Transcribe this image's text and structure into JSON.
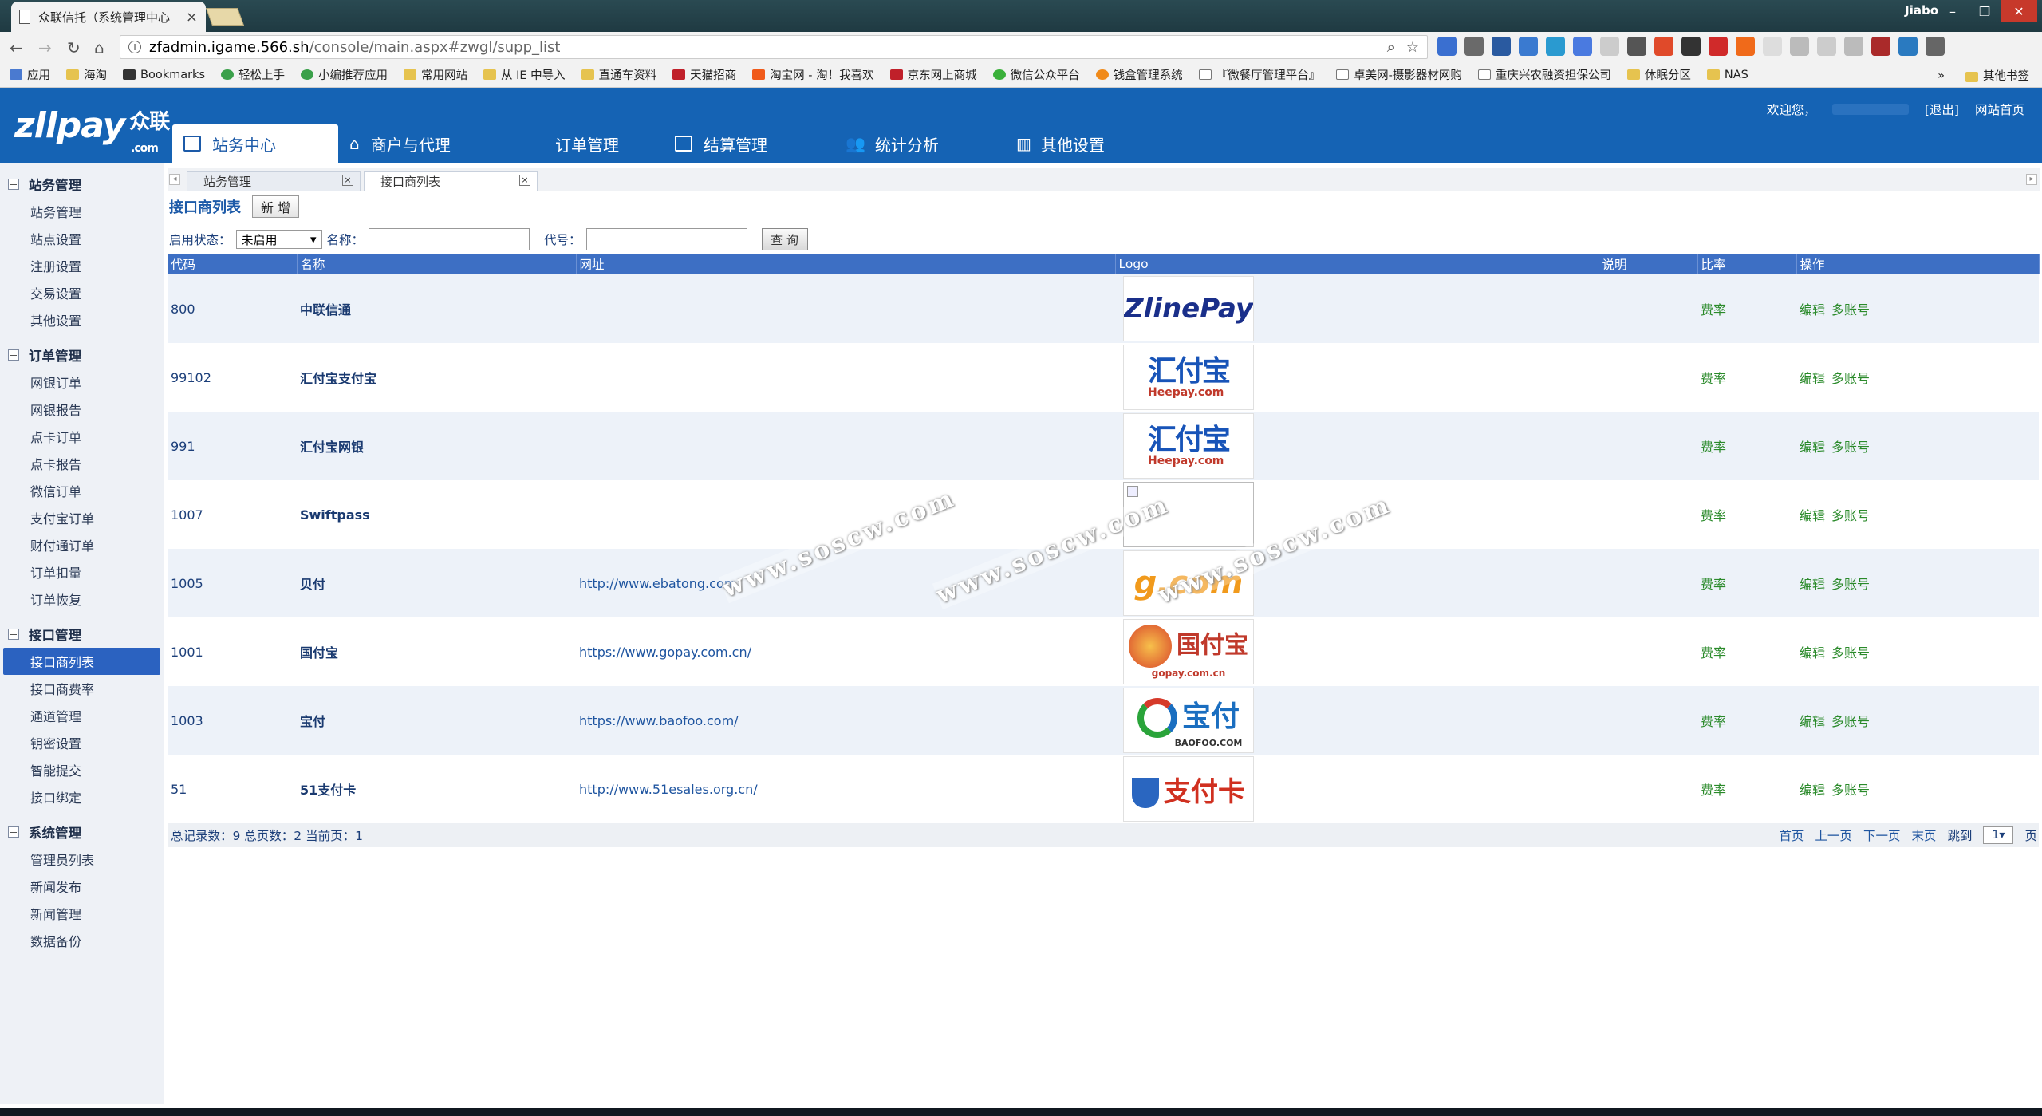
{
  "browser": {
    "tab_title": "众联信托（系统管理中心",
    "window_user": "Jiabo",
    "url_host": "zfadmin.igame.566.sh",
    "url_path": "/console/main.aspx#zwgl/supp_list",
    "bookmarks": [
      "应用",
      "海淘",
      "Bookmarks",
      "轻松上手",
      "小编推荐应用",
      "常用网站",
      "从 IE 中导入",
      "直通车资料",
      "天猫招商",
      "淘宝网 - 淘！我喜欢",
      "京东网上商城",
      "微信公众平台",
      "钱盒管理系统",
      "『微餐厅管理平台』",
      "卓美网-摄影器材网购",
      "重庆兴农融资担保公司",
      "休眠分区",
      "NAS"
    ],
    "bookmarks_overflow": "»",
    "other_bookmarks": "其他书签"
  },
  "header": {
    "logo_text": "zllpay",
    "logo_cn": "众联",
    "logo_sub": ".com",
    "nav": [
      "站务中心",
      "商户与代理",
      "订单管理",
      "结算管理",
      "统计分析",
      "其他设置"
    ],
    "welcome": "欢迎您，",
    "logout": "[退出]",
    "home": "网站首页"
  },
  "sidebar": {
    "groups": [
      {
        "title": "站务管理",
        "items": [
          "站务管理",
          "站点设置",
          "注册设置",
          "交易设置",
          "其他设置"
        ]
      },
      {
        "title": "订单管理",
        "items": [
          "网银订单",
          "网银报告",
          "点卡订单",
          "点卡报告",
          "微信订单",
          "支付宝订单",
          "财付通订单",
          "订单扣量",
          "订单恢复"
        ]
      },
      {
        "title": "接口管理",
        "items": [
          "接口商列表",
          "接口商费率",
          "通道管理",
          "钥密设置",
          "智能提交",
          "接口绑定"
        ]
      },
      {
        "title": "系统管理",
        "items": [
          "管理员列表",
          "新闻发布",
          "新闻管理",
          "数据备份"
        ]
      }
    ],
    "active_item": "接口商列表"
  },
  "content_tabs": [
    {
      "label": "站务管理"
    },
    {
      "label": "接口商列表"
    }
  ],
  "toolbar": {
    "title": "接口商列表",
    "new_button": "新 增"
  },
  "filter": {
    "status_label": "启用状态：",
    "status_value": "未启用",
    "name_label": "名称：",
    "code_label": "代号：",
    "query_button": "查 询"
  },
  "table": {
    "headers": [
      "代码",
      "名称",
      "网址",
      "Logo",
      "说明",
      "比率",
      "操作"
    ],
    "rate_link": "费率",
    "edit_link": "编辑",
    "multi_link": "多账号",
    "rows": [
      {
        "code": "800",
        "name": "中联信通",
        "url": "",
        "logo": "zlinepay",
        "logo_text": "ZlinePay"
      },
      {
        "code": "99102",
        "name": "汇付宝支付宝",
        "url": "",
        "logo": "heepay",
        "logo_text": "汇付宝",
        "logo_sub": "Heepay.com"
      },
      {
        "code": "991",
        "name": "汇付宝网银",
        "url": "",
        "logo": "heepay",
        "logo_text": "汇付宝",
        "logo_sub": "Heepay.com"
      },
      {
        "code": "1007",
        "name": "Swiftpass",
        "url": "",
        "logo": "broken",
        "logo_text": ""
      },
      {
        "code": "1005",
        "name": "贝付",
        "url": "http://www.ebatong.com",
        "logo": "ebatong",
        "logo_text": "g.com"
      },
      {
        "code": "1001",
        "name": "国付宝",
        "url": "https://www.gopay.com.cn/",
        "logo": "gopay",
        "logo_text": "国付宝",
        "logo_sub": "gopay.com.cn"
      },
      {
        "code": "1003",
        "name": "宝付",
        "url": "https://www.baofoo.com/",
        "logo": "baofoo",
        "logo_text": "宝付",
        "logo_sub": "BAOFOO.COM"
      },
      {
        "code": "51",
        "name": "51支付卡",
        "url": "http://www.51esales.org.cn/",
        "logo": "zfk",
        "logo_text": "支付卡"
      }
    ]
  },
  "footer": {
    "summary": "总记录数：9 总页数：2 当前页：1",
    "first": "首页",
    "prev": "上一页",
    "next": "下一页",
    "last": "末页",
    "jump": "跳到",
    "page_value": "1",
    "page_unit": "页"
  },
  "watermark": "www.soscw.com",
  "colors": {
    "header_blue": "#1563b4",
    "table_header": "#3d6fc4",
    "link_green": "#2a8a2a"
  }
}
